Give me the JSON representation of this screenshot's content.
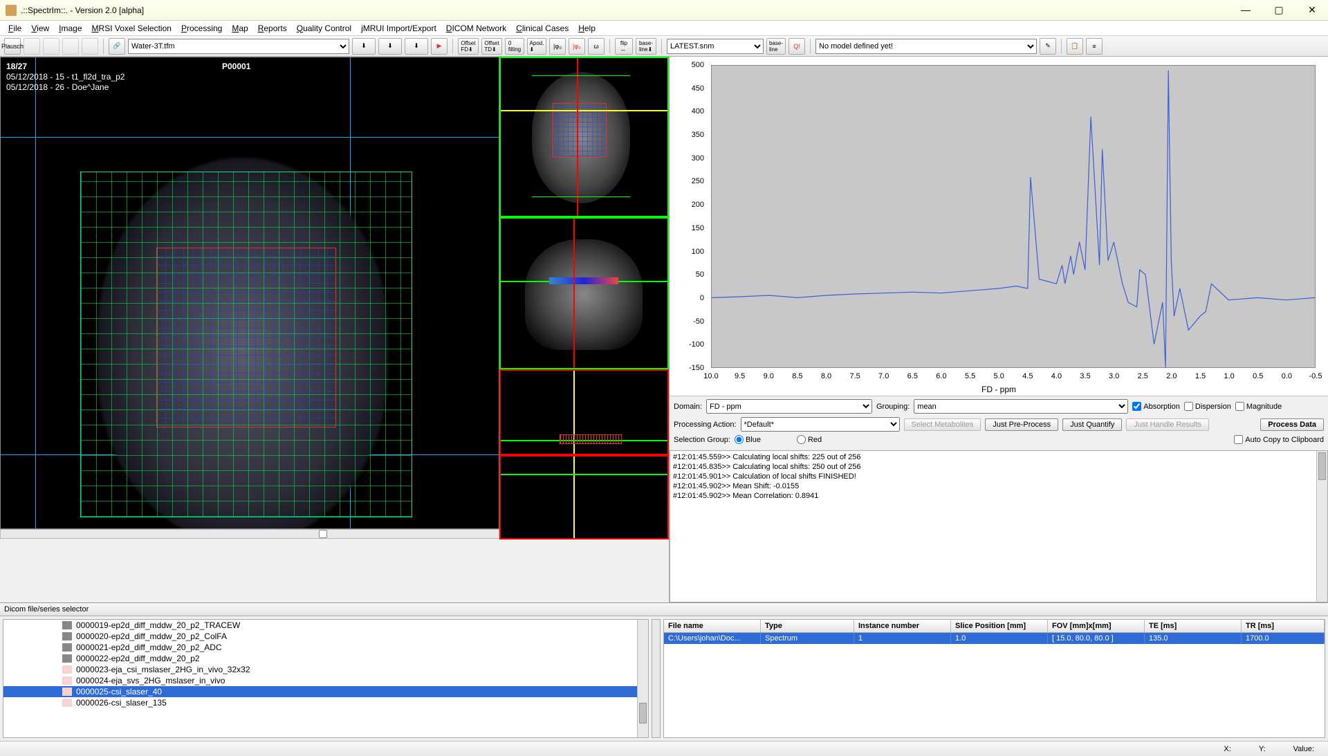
{
  "title": ".::SpectrIm::.   -   Version 2.0 [alpha]",
  "menus": [
    "File",
    "View",
    "Image",
    "MRSI Voxel Selection",
    "Processing",
    "Map",
    "Reports",
    "Quality Control",
    "jMRUI Import/Export",
    "DICOM Network",
    "Clinical Cases",
    "Help"
  ],
  "toolbar": {
    "select1": "Water-3T.tfm",
    "select2": "LATEST.snm",
    "model_text": "No model defined yet!"
  },
  "viewer": {
    "slice_counter": "18/27",
    "line1": "05/12/2018 - 15 - t1_fl2d_tra_p2",
    "line2": "05/12/2018 - 26 - Doe^Jane",
    "patient_id": "P00001"
  },
  "chart_data": {
    "type": "line",
    "title": "",
    "xlabel": "FD - ppm",
    "ylabel": "",
    "xlim": [
      10.0,
      -0.5
    ],
    "ylim": [
      -150,
      500
    ],
    "yticks": [
      -150,
      -100,
      -50,
      0,
      50,
      100,
      150,
      200,
      250,
      300,
      350,
      400,
      450,
      500
    ],
    "xticks": [
      10.0,
      9.5,
      9.0,
      8.5,
      8.0,
      7.5,
      7.0,
      6.5,
      6.0,
      5.5,
      5.0,
      4.5,
      4.0,
      3.5,
      3.0,
      2.5,
      2.0,
      1.5,
      1.0,
      0.5,
      0.0,
      -0.5
    ],
    "x": [
      10.0,
      9.5,
      9.0,
      8.5,
      8.0,
      7.5,
      7.0,
      6.5,
      6.0,
      5.5,
      5.0,
      4.7,
      4.5,
      4.45,
      4.3,
      4.0,
      3.9,
      3.85,
      3.75,
      3.7,
      3.6,
      3.5,
      3.4,
      3.25,
      3.2,
      3.1,
      3.05,
      3.0,
      2.95,
      2.85,
      2.75,
      2.6,
      2.55,
      2.45,
      2.3,
      2.15,
      2.1,
      2.05,
      2.0,
      1.95,
      1.85,
      1.7,
      1.5,
      1.4,
      1.3,
      1.0,
      0.5,
      0.0,
      -0.5
    ],
    "values": [
      0,
      2,
      5,
      0,
      5,
      8,
      10,
      12,
      10,
      15,
      20,
      25,
      20,
      260,
      40,
      30,
      70,
      30,
      90,
      50,
      120,
      60,
      390,
      70,
      320,
      80,
      100,
      120,
      90,
      30,
      -10,
      -20,
      60,
      50,
      -100,
      -10,
      -150,
      490,
      80,
      -40,
      20,
      -70,
      -40,
      -30,
      30,
      -5,
      0,
      -5,
      0
    ]
  },
  "controls": {
    "domain_label": "Domain:",
    "domain_value": "FD - ppm",
    "grouping_label": "Grouping:",
    "grouping_value": "mean",
    "absorption": "Absorption",
    "dispersion": "Dispersion",
    "magnitude": "Magnitude",
    "proc_action_label": "Processing Action:",
    "proc_action_value": "*Default*",
    "btn_select_metab": "Select Metabolites",
    "btn_preprocess": "Just Pre-Process",
    "btn_quantify": "Just Quantify",
    "btn_handle": "Just Handle Results",
    "btn_process": "Process Data",
    "sel_group_label": "Selection Group:",
    "sel_blue": "Blue",
    "sel_red": "Red",
    "autocopy": "Auto Copy to Clipboard"
  },
  "log": [
    "#12:01:45.559>> Calculating local shifts: 225 out of 256",
    "#12:01:45.835>> Calculating local shifts: 250 out of 256",
    "#12:01:45.901>> Calculation of local shifts FINISHED!",
    "#12:01:45.902>> Mean Shift: -0.0155",
    "#12:01:45.902>> Mean Correlation: 0.8941"
  ],
  "bottom": {
    "title": "Dicom file/series selector",
    "tree": [
      "0000019-ep2d_diff_mddw_20_p2_TRACEW",
      "0000020-ep2d_diff_mddw_20_p2_ColFA",
      "0000021-ep2d_diff_mddw_20_p2_ADC",
      "0000022-ep2d_diff_mddw_20_p2",
      "0000023-eja_csi_mslaser_2HG_in_vivo_32x32",
      "0000024-eja_svs_2HG_mslaser_in_vivo",
      "0000025-csi_slaser_40",
      "0000026-csi_slaser_135"
    ],
    "tree_selected_index": 6,
    "table_headers": [
      "File name",
      "Type",
      "Instance number",
      "Slice Position [mm]",
      "FOV [mm]x[mm]",
      "TE [ms]",
      "TR [ms]"
    ],
    "table_widths": [
      140,
      140,
      140,
      140,
      140,
      140,
      140
    ],
    "table_row": [
      "C:\\Users\\johan\\Doc...",
      "Spectrum",
      "1",
      "1.0",
      "[ 15.0, 80.0, 80.0 ]",
      "135.0",
      "1700.0"
    ]
  },
  "statusbar": {
    "x": "X:",
    "y": "Y:",
    "value": "Value:"
  }
}
